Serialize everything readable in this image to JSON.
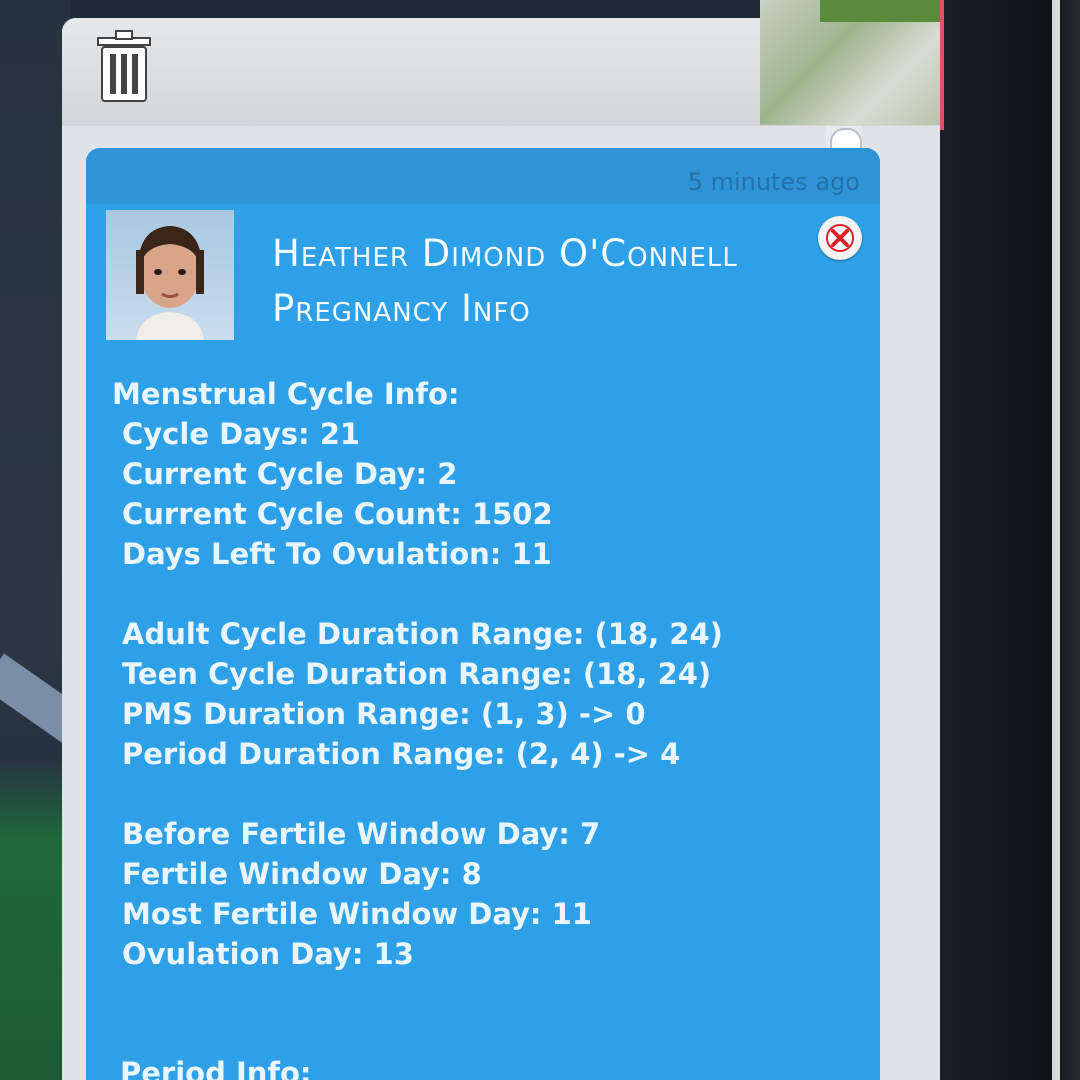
{
  "notification": {
    "timestamp": "5 minutes ago",
    "title": "Heather Dimond O'Connell Pregnancy Info",
    "sections": [
      {
        "heading": "Menstrual Cycle Info:",
        "lines": [
          "Cycle Days: 21",
          "Current Cycle Day: 2",
          "Current Cycle Count: 1502",
          "Days Left To Ovulation: 11"
        ]
      },
      {
        "lines": [
          "Adult Cycle Duration Range: (18, 24)",
          "Teen Cycle Duration Range: (18, 24)",
          "PMS Duration Range: (1, 3) -> 0",
          "Period Duration Range: (2, 4) -> 4"
        ]
      },
      {
        "lines": [
          "Before Fertile Window Day: 7",
          "Fertile Window Day: 8",
          "Most Fertile Window Day: 11",
          "Ovulation Day: 13"
        ]
      }
    ],
    "next_heading": "Period Info:"
  },
  "icons": {
    "trash": "trash-icon",
    "close": "close-icon",
    "avatar": "sim-portrait"
  },
  "colors": {
    "card_blue": "#2da0e8",
    "close_red": "#d9222a"
  }
}
